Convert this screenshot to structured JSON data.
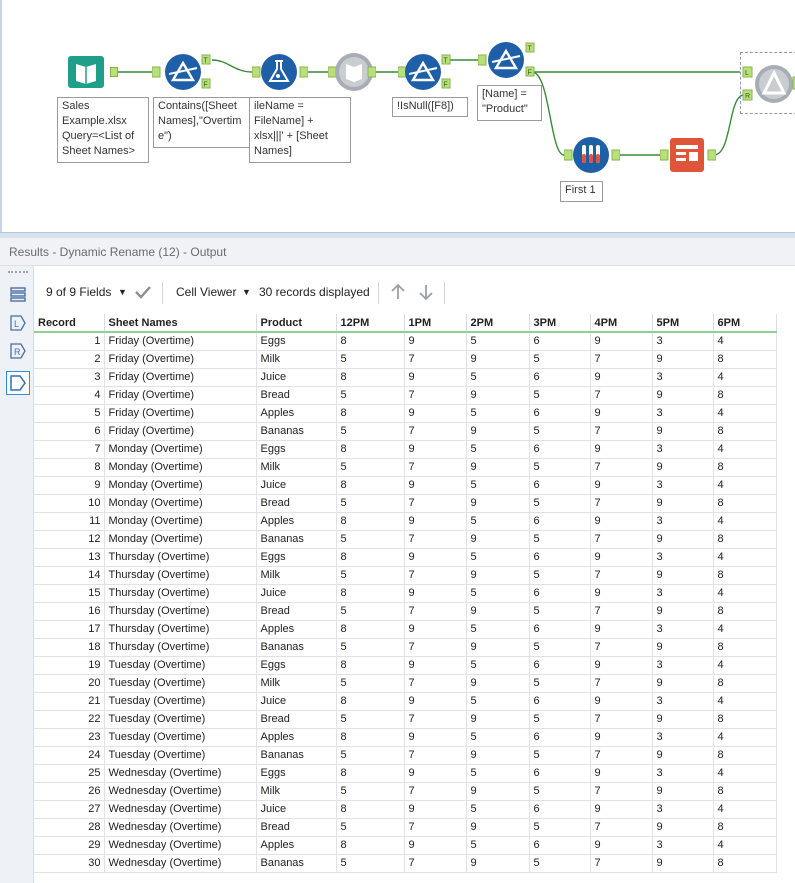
{
  "workflow": {
    "annotations": {
      "input": "Sales\nExample.xlsx\nQuery=<List of\nSheet Names>",
      "filter1": "Contains([Sheet\nNames],\"Overtim\ne\")",
      "formula": "ileName =\nFileName] +\nxlsx|||' + [Sheet\nNames]",
      "filter2": "!IsNull([F8])",
      "filter3": "[Name] =\n\"Product\"",
      "sample": "First 1"
    },
    "anchors": {
      "true": "T",
      "false": "F",
      "left": "L",
      "right": "R"
    },
    "colors": {
      "filter": "#1e5fa8",
      "input": "#1f9e8a",
      "sample": "#1e5fa8",
      "dynamic": "#e0553a",
      "wire": "#3a8a3a"
    }
  },
  "results": {
    "title": "Results - Dynamic Rename (12) - Output",
    "fields_label": "9 of 9 Fields",
    "viewer_label": "Cell Viewer",
    "records_label": "30 records displayed"
  },
  "table": {
    "columns": [
      "Record",
      "Sheet Names",
      "Product",
      "12PM",
      "1PM",
      "2PM",
      "3PM",
      "4PM",
      "5PM",
      "6PM"
    ],
    "rows": [
      [
        "1",
        "Friday (Overtime)",
        "Eggs",
        "8",
        "9",
        "5",
        "6",
        "9",
        "3",
        "4"
      ],
      [
        "2",
        "Friday (Overtime)",
        "Milk",
        "5",
        "7",
        "9",
        "5",
        "7",
        "9",
        "8"
      ],
      [
        "3",
        "Friday (Overtime)",
        "Juice",
        "8",
        "9",
        "5",
        "6",
        "9",
        "3",
        "4"
      ],
      [
        "4",
        "Friday (Overtime)",
        "Bread",
        "5",
        "7",
        "9",
        "5",
        "7",
        "9",
        "8"
      ],
      [
        "5",
        "Friday (Overtime)",
        "Apples",
        "8",
        "9",
        "5",
        "6",
        "9",
        "3",
        "4"
      ],
      [
        "6",
        "Friday (Overtime)",
        "Bananas",
        "5",
        "7",
        "9",
        "5",
        "7",
        "9",
        "8"
      ],
      [
        "7",
        "Monday (Overtime)",
        "Eggs",
        "8",
        "9",
        "5",
        "6",
        "9",
        "3",
        "4"
      ],
      [
        "8",
        "Monday (Overtime)",
        "Milk",
        "5",
        "7",
        "9",
        "5",
        "7",
        "9",
        "8"
      ],
      [
        "9",
        "Monday (Overtime)",
        "Juice",
        "8",
        "9",
        "5",
        "6",
        "9",
        "3",
        "4"
      ],
      [
        "10",
        "Monday (Overtime)",
        "Bread",
        "5",
        "7",
        "9",
        "5",
        "7",
        "9",
        "8"
      ],
      [
        "11",
        "Monday (Overtime)",
        "Apples",
        "8",
        "9",
        "5",
        "6",
        "9",
        "3",
        "4"
      ],
      [
        "12",
        "Monday (Overtime)",
        "Bananas",
        "5",
        "7",
        "9",
        "5",
        "7",
        "9",
        "8"
      ],
      [
        "13",
        "Thursday (Overtime)",
        "Eggs",
        "8",
        "9",
        "5",
        "6",
        "9",
        "3",
        "4"
      ],
      [
        "14",
        "Thursday (Overtime)",
        "Milk",
        "5",
        "7",
        "9",
        "5",
        "7",
        "9",
        "8"
      ],
      [
        "15",
        "Thursday (Overtime)",
        "Juice",
        "8",
        "9",
        "5",
        "6",
        "9",
        "3",
        "4"
      ],
      [
        "16",
        "Thursday (Overtime)",
        "Bread",
        "5",
        "7",
        "9",
        "5",
        "7",
        "9",
        "8"
      ],
      [
        "17",
        "Thursday (Overtime)",
        "Apples",
        "8",
        "9",
        "5",
        "6",
        "9",
        "3",
        "4"
      ],
      [
        "18",
        "Thursday (Overtime)",
        "Bananas",
        "5",
        "7",
        "9",
        "5",
        "7",
        "9",
        "8"
      ],
      [
        "19",
        "Tuesday (Overtime)",
        "Eggs",
        "8",
        "9",
        "5",
        "6",
        "9",
        "3",
        "4"
      ],
      [
        "20",
        "Tuesday (Overtime)",
        "Milk",
        "5",
        "7",
        "9",
        "5",
        "7",
        "9",
        "8"
      ],
      [
        "21",
        "Tuesday (Overtime)",
        "Juice",
        "8",
        "9",
        "5",
        "6",
        "9",
        "3",
        "4"
      ],
      [
        "22",
        "Tuesday (Overtime)",
        "Bread",
        "5",
        "7",
        "9",
        "5",
        "7",
        "9",
        "8"
      ],
      [
        "23",
        "Tuesday (Overtime)",
        "Apples",
        "8",
        "9",
        "5",
        "6",
        "9",
        "3",
        "4"
      ],
      [
        "24",
        "Tuesday (Overtime)",
        "Bananas",
        "5",
        "7",
        "9",
        "5",
        "7",
        "9",
        "8"
      ],
      [
        "25",
        "Wednesday (Overtime)",
        "Eggs",
        "8",
        "9",
        "5",
        "6",
        "9",
        "3",
        "4"
      ],
      [
        "26",
        "Wednesday (Overtime)",
        "Milk",
        "5",
        "7",
        "9",
        "5",
        "7",
        "9",
        "8"
      ],
      [
        "27",
        "Wednesday (Overtime)",
        "Juice",
        "8",
        "9",
        "5",
        "6",
        "9",
        "3",
        "4"
      ],
      [
        "28",
        "Wednesday (Overtime)",
        "Bread",
        "5",
        "7",
        "9",
        "5",
        "7",
        "9",
        "8"
      ],
      [
        "29",
        "Wednesday (Overtime)",
        "Apples",
        "8",
        "9",
        "5",
        "6",
        "9",
        "3",
        "4"
      ],
      [
        "30",
        "Wednesday (Overtime)",
        "Bananas",
        "5",
        "7",
        "9",
        "5",
        "7",
        "9",
        "8"
      ]
    ]
  }
}
